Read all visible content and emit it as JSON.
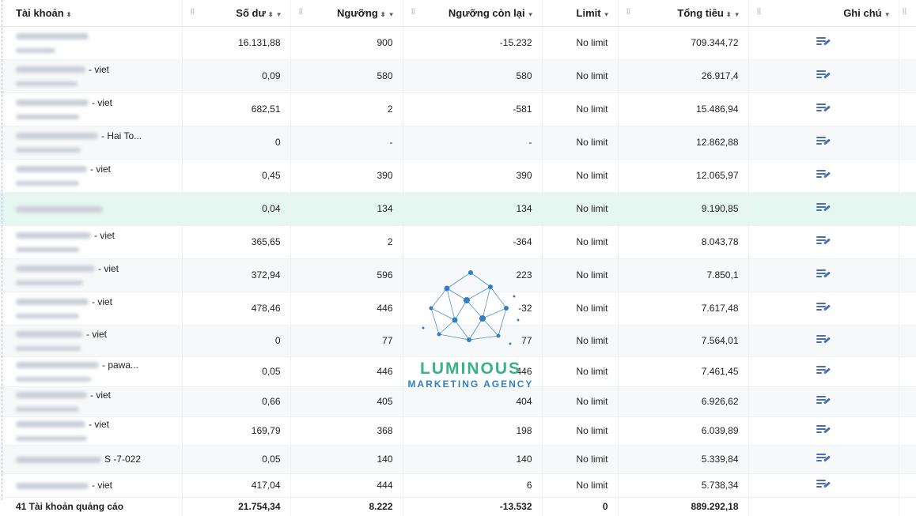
{
  "columns": [
    "Tài khoản",
    "Số dư",
    "Ngưỡng",
    "Ngưỡng còn lại",
    "Limit",
    "Tổng tiêu",
    "Ghi chú"
  ],
  "rows": [
    {
      "suffix": "",
      "so_du": "16.131,88",
      "nguong": "900",
      "con_lai": "-15.232",
      "limit": "No limit",
      "tong_tieu": "709.344,72"
    },
    {
      "suffix": "- viet",
      "so_du": "0,09",
      "nguong": "580",
      "con_lai": "580",
      "limit": "No limit",
      "tong_tieu": "26.917,4"
    },
    {
      "suffix": "- viet",
      "so_du": "682,51",
      "nguong": "2",
      "con_lai": "-581",
      "limit": "No limit",
      "tong_tieu": "15.486,94"
    },
    {
      "suffix": "- Hai To...",
      "so_du": "0",
      "nguong": "-",
      "con_lai": "-",
      "limit": "No limit",
      "tong_tieu": "12.862,88"
    },
    {
      "suffix": "- viet",
      "so_du": "0,45",
      "nguong": "390",
      "con_lai": "390",
      "limit": "No limit",
      "tong_tieu": "12.065,97"
    },
    {
      "suffix": "",
      "so_du": "0,04",
      "nguong": "134",
      "con_lai": "134",
      "limit": "No limit",
      "tong_tieu": "9.190,85"
    },
    {
      "suffix": "- viet",
      "so_du": "365,65",
      "nguong": "2",
      "con_lai": "-364",
      "limit": "No limit",
      "tong_tieu": "8.043,78"
    },
    {
      "suffix": "- viet",
      "so_du": "372,94",
      "nguong": "596",
      "con_lai": "223",
      "limit": "No limit",
      "tong_tieu": "7.850,1"
    },
    {
      "suffix": "- viet",
      "so_du": "478,46",
      "nguong": "446",
      "con_lai": "-32",
      "limit": "No limit",
      "tong_tieu": "7.617,48"
    },
    {
      "suffix": "- viet",
      "so_du": "0",
      "nguong": "77",
      "con_lai": "77",
      "limit": "No limit",
      "tong_tieu": "7.564,01"
    },
    {
      "suffix": "- pawa...",
      "so_du": "0,05",
      "nguong": "446",
      "con_lai": "446",
      "limit": "No limit",
      "tong_tieu": "7.461,45"
    },
    {
      "suffix": "- viet",
      "so_du": "0,66",
      "nguong": "405",
      "con_lai": "404",
      "limit": "No limit",
      "tong_tieu": "6.926,62"
    },
    {
      "suffix": "- viet",
      "so_du": "169,79",
      "nguong": "368",
      "con_lai": "198",
      "limit": "No limit",
      "tong_tieu": "6.039,89"
    },
    {
      "suffix": "S -7-022",
      "so_du": "0,05",
      "nguong": "140",
      "con_lai": "140",
      "limit": "No limit",
      "tong_tieu": "5.339,84"
    },
    {
      "suffix": "- viet",
      "so_du": "417,04",
      "nguong": "444",
      "con_lai": "6",
      "limit": "No limit",
      "tong_tieu": "5.738,34"
    }
  ],
  "footer": {
    "label": "41 Tài khoản quảng cáo",
    "so_du": "21.754,34",
    "nguong": "8.222",
    "con_lai": "-13.532",
    "limit": "0",
    "tong_tieu": "889.292,18"
  },
  "watermark": {
    "line1": "LUMINOUS",
    "line2": "MARKETING AGENCY",
    "color_green": "#3bb08a",
    "color_blue": "#2f7fc6"
  },
  "icons": {
    "sort": "sort-arrows-icon",
    "dropdown": "caret-down-icon",
    "note": "edit-note-icon",
    "grip": "column-grip-icon"
  }
}
